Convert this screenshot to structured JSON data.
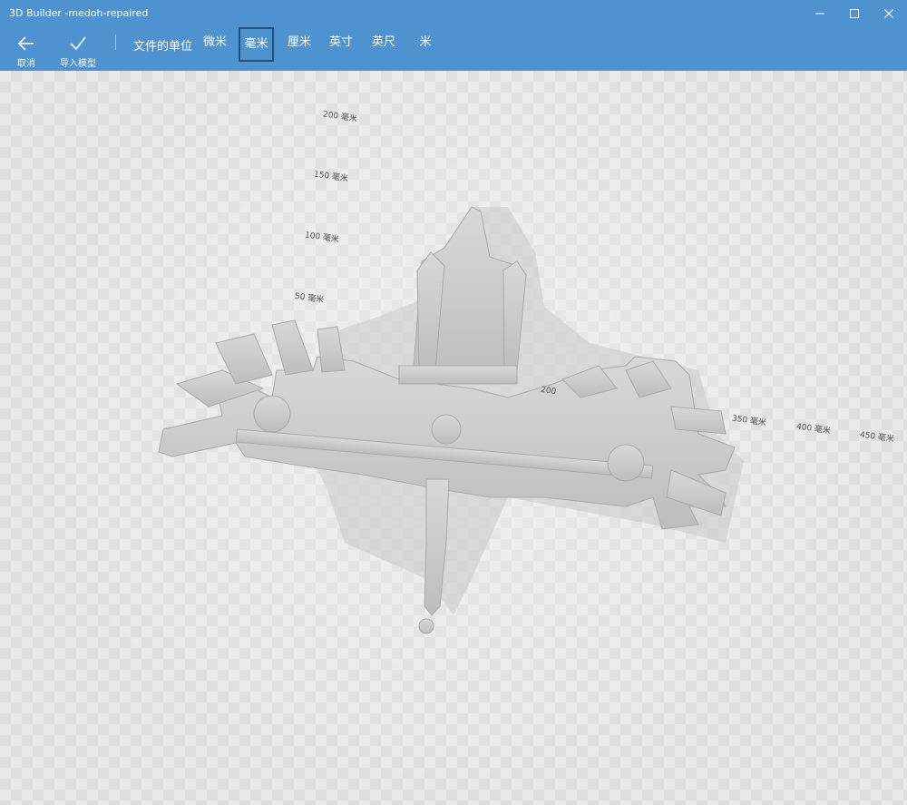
{
  "window": {
    "title": "3D Builder -medoh-repaired"
  },
  "toolbar": {
    "cancel_label": "取消",
    "import_label": "导入模型",
    "units_label": "文件的单位",
    "units": [
      {
        "label": "微米",
        "selected": false
      },
      {
        "label": "毫米",
        "selected": true
      },
      {
        "label": "厘米",
        "selected": false
      },
      {
        "label": "英寸",
        "selected": false
      },
      {
        "label": "英尺",
        "selected": false
      },
      {
        "label": "米",
        "selected": false
      }
    ]
  },
  "viewport": {
    "rulers": [
      "200 毫米",
      "150 毫米",
      "100 毫米",
      "50 毫米",
      "200",
      "350 毫米",
      "400 毫米",
      "450 毫米"
    ]
  },
  "colors": {
    "accent": "#4e93cf",
    "selected_border": "#1f4f7a",
    "model": "#cfcfcf"
  },
  "icons": [
    "back-arrow-icon",
    "checkmark-icon",
    "minimize-icon",
    "maximize-icon",
    "close-icon"
  ]
}
